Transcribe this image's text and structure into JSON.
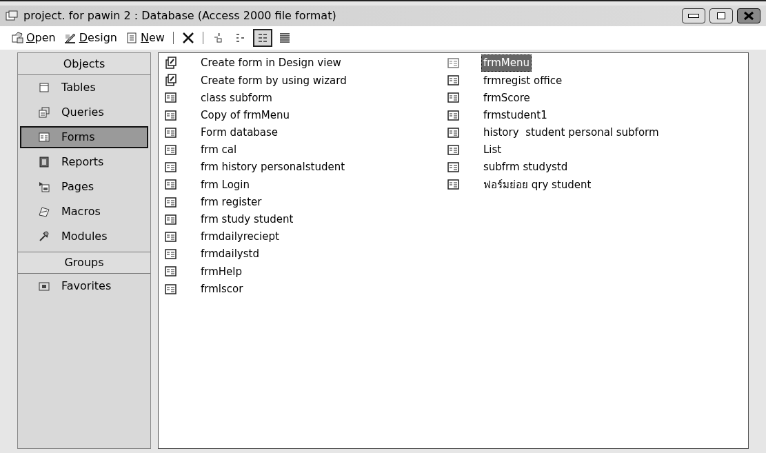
{
  "window": {
    "title": "project. for pawin 2 : Database (Access 2000 file format)"
  },
  "toolbar": {
    "buttons": [
      {
        "label": "Open",
        "kind": "open"
      },
      {
        "label": "Design",
        "kind": "design"
      },
      {
        "label": "New",
        "kind": "new"
      }
    ],
    "view_buttons": [
      {
        "kind": "large",
        "selected": false
      },
      {
        "kind": "small",
        "selected": false
      },
      {
        "kind": "list",
        "selected": true
      },
      {
        "kind": "details",
        "selected": false
      }
    ]
  },
  "sidebar": {
    "items": [
      {
        "kind": "header",
        "label": "Objects"
      },
      {
        "kind": "item",
        "label": "Tables",
        "selected": false
      },
      {
        "kind": "item",
        "label": "Queries",
        "selected": false
      },
      {
        "kind": "item",
        "label": "Forms",
        "selected": true
      },
      {
        "kind": "item",
        "label": "Reports",
        "selected": false
      },
      {
        "kind": "item",
        "label": "Pages",
        "selected": false
      },
      {
        "kind": "item",
        "label": "Macros",
        "selected": false
      },
      {
        "kind": "item",
        "label": "Modules",
        "selected": false
      },
      {
        "kind": "header",
        "label": "Groups"
      },
      {
        "kind": "item",
        "label": "Favorites",
        "selected": false
      }
    ]
  },
  "list": {
    "columns": [
      [
        {
          "kind": "shortcut",
          "label": "Create form in Design view",
          "selected": false
        },
        {
          "kind": "shortcut",
          "label": "Create form by using wizard",
          "selected": false
        },
        {
          "kind": "form",
          "label": "class subform",
          "selected": false
        },
        {
          "kind": "form",
          "label": "Copy of frmMenu",
          "selected": false
        },
        {
          "kind": "form",
          "label": "Form database",
          "selected": false
        },
        {
          "kind": "form",
          "label": "frm cal",
          "selected": false
        },
        {
          "kind": "form",
          "label": "frm history personalstudent",
          "selected": false
        },
        {
          "kind": "form",
          "label": "frm Login",
          "selected": false
        },
        {
          "kind": "form",
          "label": "frm register",
          "selected": false
        },
        {
          "kind": "form",
          "label": "frm study student",
          "selected": false
        },
        {
          "kind": "form",
          "label": "frmdailyreciept",
          "selected": false
        },
        {
          "kind": "form",
          "label": "frmdailystd",
          "selected": false
        },
        {
          "kind": "form",
          "label": "frmHelp",
          "selected": false
        },
        {
          "kind": "form",
          "label": "frmlscor",
          "selected": false
        }
      ],
      [
        {
          "kind": "form",
          "label": "frmMenu",
          "selected": true
        },
        {
          "kind": "form",
          "label": "frmregist office",
          "selected": false
        },
        {
          "kind": "form",
          "label": "frmScore",
          "selected": false
        },
        {
          "kind": "form",
          "label": "frmstudent1",
          "selected": false
        },
        {
          "kind": "form",
          "label": "history  student personal subform",
          "selected": false
        },
        {
          "kind": "form",
          "label": "List",
          "selected": false
        },
        {
          "kind": "form",
          "label": "subfrm studystd",
          "selected": false
        },
        {
          "kind": "form",
          "label": "ฟอร์มย่อย qry student",
          "selected": false
        }
      ]
    ]
  }
}
